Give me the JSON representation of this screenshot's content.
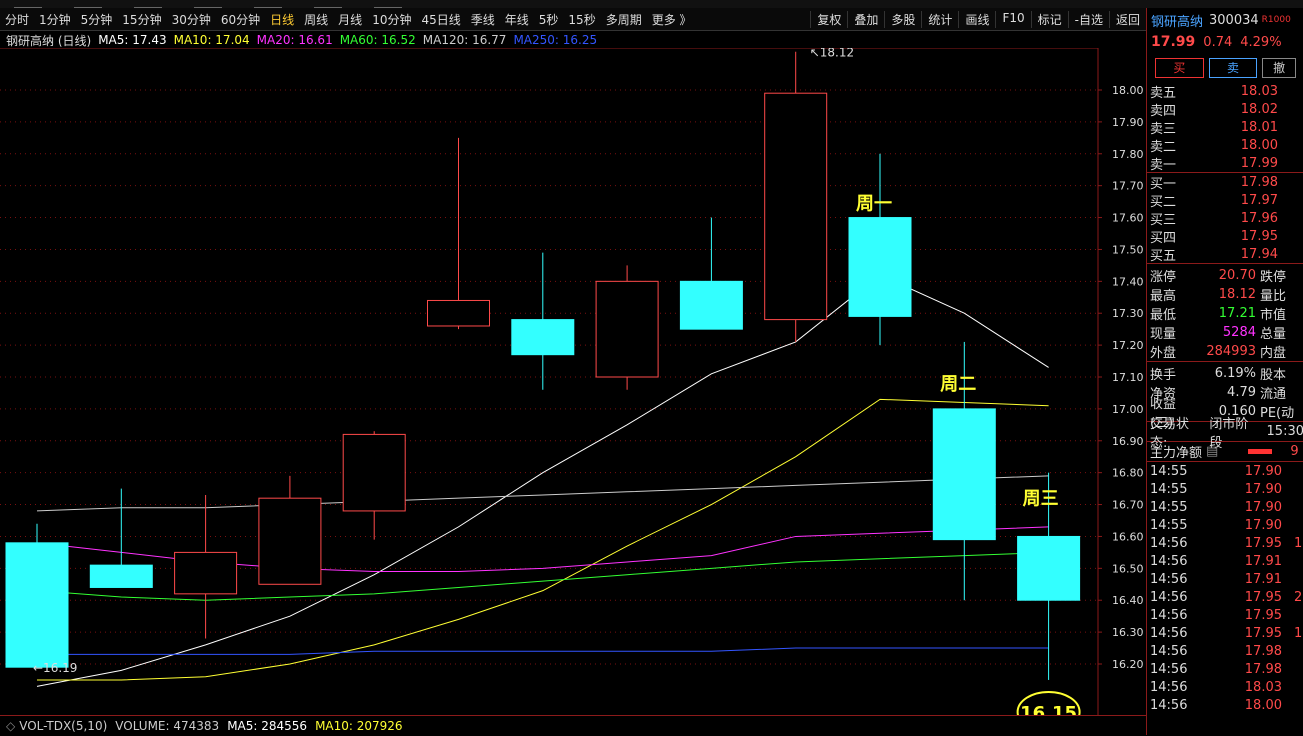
{
  "toolbar": {
    "periods": [
      "分时",
      "1分钟",
      "5分钟",
      "15分钟",
      "30分钟",
      "60分钟",
      "日线",
      "周线",
      "月线",
      "10分钟",
      "45日线",
      "季线",
      "年线",
      "5秒",
      "15秒",
      "多周期",
      "更多 》"
    ],
    "active_period": "日线",
    "actions": [
      "复权",
      "叠加",
      "多股",
      "统计",
      "画线",
      "F10",
      "标记",
      "-自选",
      "返回"
    ]
  },
  "ma_legend": {
    "title": "钢研高纳 (日线)",
    "items": [
      {
        "text": "MA5: 17.43",
        "color": "#ffffff"
      },
      {
        "text": "MA10: 17.04",
        "color": "#ffff33"
      },
      {
        "text": "MA20: 16.61",
        "color": "#ff33ff"
      },
      {
        "text": "MA60: 16.52",
        "color": "#33ff33"
      },
      {
        "text": "MA120: 16.77",
        "color": "#cccccc"
      },
      {
        "text": "MA250: 16.25",
        "color": "#3355ff"
      }
    ]
  },
  "chart_data": {
    "type": "candlestick",
    "y_ticks": [
      "18.00",
      "17.90",
      "17.80",
      "17.70",
      "17.60",
      "17.50",
      "17.40",
      "17.30",
      "17.20",
      "17.10",
      "17.00",
      "16.90",
      "16.80",
      "16.70",
      "16.60",
      "16.50",
      "16.40",
      "16.30",
      "16.20"
    ],
    "ylim": [
      16.05,
      18.3
    ],
    "candles": [
      {
        "open": 16.58,
        "close": 16.19,
        "high": 16.64,
        "low": 16.19
      },
      {
        "open": 16.51,
        "close": 16.44,
        "high": 16.75,
        "low": 16.44
      },
      {
        "open": 16.42,
        "close": 16.55,
        "high": 16.73,
        "low": 16.28
      },
      {
        "open": 16.45,
        "close": 16.72,
        "high": 16.79,
        "low": 16.45
      },
      {
        "open": 16.68,
        "close": 16.92,
        "high": 16.93,
        "low": 16.59
      },
      {
        "open": 17.26,
        "close": 17.34,
        "high": 17.85,
        "low": 17.25
      },
      {
        "open": 17.28,
        "close": 17.17,
        "high": 17.49,
        "low": 17.06
      },
      {
        "open": 17.1,
        "close": 17.4,
        "high": 17.45,
        "low": 17.06
      },
      {
        "open": 17.4,
        "close": 17.25,
        "high": 17.6,
        "low": 17.25
      },
      {
        "open": 17.28,
        "close": 17.99,
        "high": 18.12,
        "low": 17.21
      },
      {
        "open": 17.6,
        "close": 17.29,
        "high": 17.8,
        "low": 17.2
      },
      {
        "open": 17.0,
        "close": 16.59,
        "high": 17.21,
        "low": 16.4
      },
      {
        "open": 16.6,
        "close": 16.4,
        "high": 16.8,
        "low": 16.15
      }
    ],
    "ma": [
      {
        "name": "MA5",
        "color": "#ffffff",
        "values": [
          16.13,
          16.18,
          16.26,
          16.35,
          16.48,
          16.63,
          16.8,
          16.95,
          17.11,
          17.21,
          17.42,
          17.3,
          17.13
        ]
      },
      {
        "name": "MA10",
        "color": "#ffff33",
        "values": [
          16.15,
          16.15,
          16.16,
          16.2,
          16.26,
          16.34,
          16.43,
          16.57,
          16.7,
          16.85,
          17.03,
          17.02,
          17.01
        ]
      },
      {
        "name": "MA20",
        "color": "#ff33ff",
        "values": [
          16.58,
          16.55,
          16.52,
          16.5,
          16.49,
          16.49,
          16.5,
          16.52,
          16.54,
          16.6,
          16.61,
          16.62,
          16.63
        ]
      },
      {
        "name": "MA60",
        "color": "#33ff33",
        "values": [
          16.43,
          16.41,
          16.4,
          16.41,
          16.42,
          16.44,
          16.46,
          16.48,
          16.5,
          16.52,
          16.53,
          16.54,
          16.55
        ]
      },
      {
        "name": "MA120",
        "color": "#cccccc",
        "values": [
          16.68,
          16.69,
          16.69,
          16.7,
          16.71,
          16.72,
          16.73,
          16.74,
          16.75,
          16.76,
          16.77,
          16.78,
          16.79
        ]
      },
      {
        "name": "MA250",
        "color": "#3355ff",
        "values": [
          16.23,
          16.23,
          16.23,
          16.23,
          16.24,
          16.24,
          16.24,
          16.24,
          16.24,
          16.25,
          16.25,
          16.25,
          16.25
        ]
      }
    ],
    "annotations": {
      "high_label": "18.12",
      "low_label": "16.19",
      "low_circle": "16.15",
      "day1": "周一",
      "day2": "周二",
      "day3": "周三"
    }
  },
  "volume": {
    "title": "VOL-TDX(5,10)",
    "volume": "VOLUME: 474383",
    "ma5": "MA5: 284556",
    "ma10": "MA10: 207926"
  },
  "quote": {
    "name": "钢研高纳",
    "code": "300034",
    "tag": "R1000",
    "price": "17.99",
    "change": "0.74",
    "pct": "4.29%",
    "buy_label": "买",
    "sell_label": "卖",
    "cancel_label": "撤",
    "asks": [
      {
        "label": "卖五",
        "price": "18.03"
      },
      {
        "label": "卖四",
        "price": "18.02"
      },
      {
        "label": "卖三",
        "price": "18.01"
      },
      {
        "label": "卖二",
        "price": "18.00"
      },
      {
        "label": "卖一",
        "price": "17.99"
      }
    ],
    "bids": [
      {
        "label": "买一",
        "price": "17.98"
      },
      {
        "label": "买二",
        "price": "17.97"
      },
      {
        "label": "买三",
        "price": "17.96"
      },
      {
        "label": "买四",
        "price": "17.95"
      },
      {
        "label": "买五",
        "price": "17.94"
      }
    ],
    "stats": [
      {
        "label": "涨停",
        "value": "20.70",
        "color": "#ff4a4a",
        "extra": "跌停"
      },
      {
        "label": "最高",
        "value": "18.12",
        "color": "#ff4a4a",
        "extra": "量比"
      },
      {
        "label": "最低",
        "value": "17.21",
        "color": "#33ff33",
        "extra": "市值"
      },
      {
        "label": "现量",
        "value": "5284",
        "color": "#ff33ff",
        "extra": "总量"
      },
      {
        "label": "外盘",
        "value": "284993",
        "color": "#ff4a4a",
        "extra": "内盘"
      }
    ],
    "stats2": [
      {
        "label": "换手",
        "value": "6.19%",
        "color": "#ddd",
        "extra": "股本"
      },
      {
        "label": "净资",
        "value": "4.79",
        "color": "#ddd",
        "extra": "流通"
      },
      {
        "label": "收益(三)",
        "value": "0.160",
        "color": "#ddd",
        "extra": "PE(动"
      }
    ],
    "trade_status_label": "交易状态:",
    "trade_status": "闭市阶段",
    "trade_time": "15:30",
    "main_flow_label": "主力净额",
    "main_flow_value": "9",
    "ticks": [
      {
        "time": "14:55",
        "price": "17.90",
        "vol": ""
      },
      {
        "time": "14:55",
        "price": "17.90",
        "vol": ""
      },
      {
        "time": "14:55",
        "price": "17.90",
        "vol": ""
      },
      {
        "time": "14:55",
        "price": "17.90",
        "vol": ""
      },
      {
        "time": "14:56",
        "price": "17.95",
        "vol": "1"
      },
      {
        "time": "14:56",
        "price": "17.91",
        "vol": ""
      },
      {
        "time": "14:56",
        "price": "17.91",
        "vol": ""
      },
      {
        "time": "14:56",
        "price": "17.95",
        "vol": "2"
      },
      {
        "time": "14:56",
        "price": "17.95",
        "vol": ""
      },
      {
        "time": "14:56",
        "price": "17.95",
        "vol": "1"
      },
      {
        "time": "14:56",
        "price": "17.98",
        "vol": ""
      },
      {
        "time": "14:56",
        "price": "17.98",
        "vol": ""
      },
      {
        "time": "14:56",
        "price": "18.03",
        "vol": ""
      },
      {
        "time": "14:56",
        "price": "18.00",
        "vol": ""
      }
    ]
  }
}
